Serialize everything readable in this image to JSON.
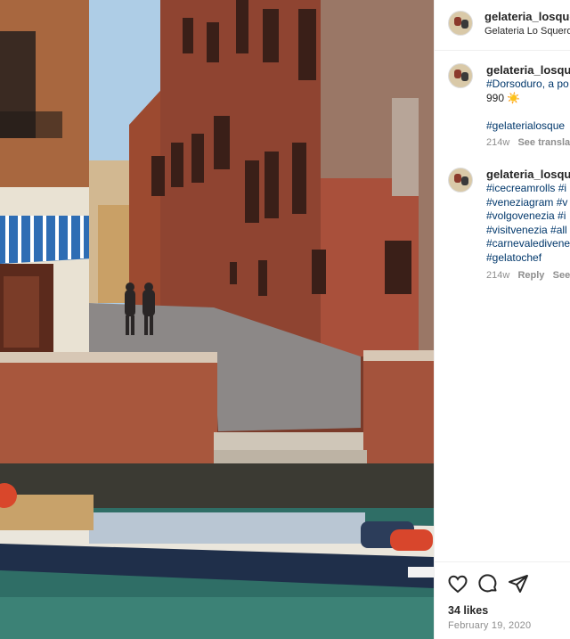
{
  "post": {
    "photo_alt_name": "venice-canal-photo"
  },
  "header": {
    "username": "gelateria_losque",
    "location": "Gelateria Lo Squero"
  },
  "comments": [
    {
      "username": "gelateria_losque",
      "lines": [
        "#Dorsoduro, a po",
        "990 ☀️",
        "",
        "#gelaterialosque"
      ],
      "time": "214w",
      "action": "See translat"
    },
    {
      "username": "gelateria_losque",
      "lines": [
        "#icecreamrolls #i",
        "#veneziagram #v",
        "#volgovenezia #i",
        "#visitvenezia #all",
        "#carnevaledivene",
        "#gelatochef"
      ],
      "time": "214w",
      "reply": "Reply",
      "action": "See"
    }
  ],
  "footer": {
    "likes": "34 likes",
    "date": "February 19, 2020"
  },
  "icons": [
    "like-icon",
    "comment-icon",
    "share-icon"
  ],
  "colors": {
    "hashtag": "#00376b",
    "muted": "#8e8e8e",
    "text": "#262626"
  }
}
